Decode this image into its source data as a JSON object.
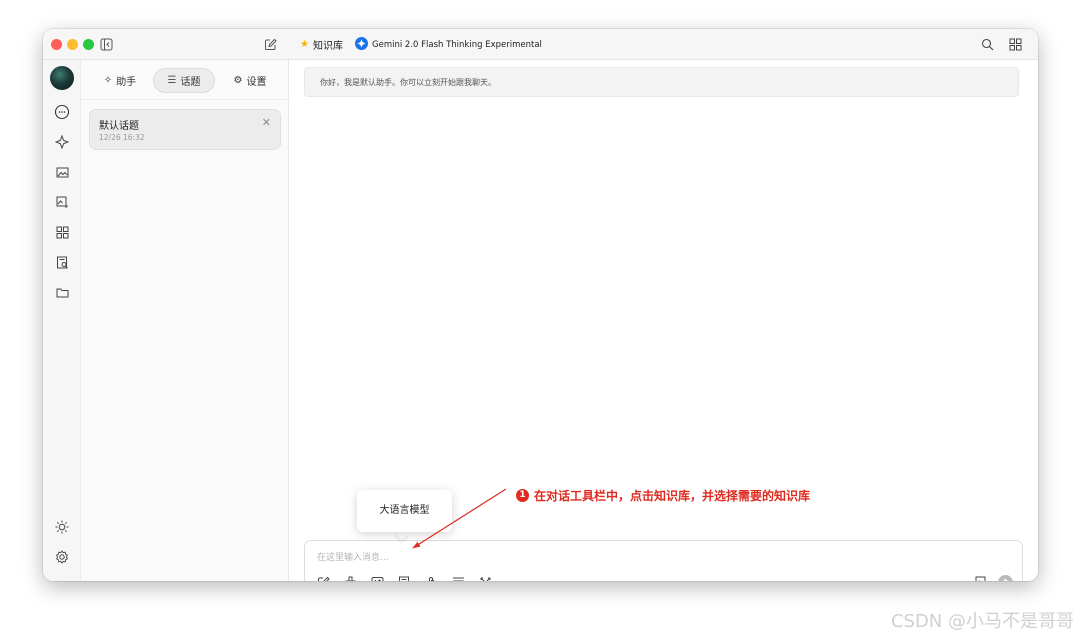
{
  "titlebar": {
    "knowledge_label": "知识库",
    "model_name": "Gemini 2.0 Flash Thinking Experimental"
  },
  "sidebar": {
    "tabs": [
      {
        "label": "助手",
        "icon": "sparkle-icon"
      },
      {
        "label": "话题",
        "icon": "list-icon"
      },
      {
        "label": "设置",
        "icon": "gear-icon"
      }
    ],
    "active_tab": "话题",
    "topics": [
      {
        "title": "默认话题",
        "time": "12/26 16:32"
      }
    ]
  },
  "chat": {
    "messages": [
      {
        "role": "assistant",
        "text": "你好，我是默认助手。你可以立刻开始跟我聊天。"
      }
    ]
  },
  "input": {
    "placeholder": "在这里输入消息..."
  },
  "tooltip": {
    "text": "大语言模型"
  },
  "annotation": {
    "number": "1",
    "text": "在对话工具栏中，点击知识库，并选择需要的知识库"
  },
  "watermark": "CSDN @小马不是哥哥",
  "colors": {
    "annotation": "#e02a20",
    "tl_red": "#fe5f57",
    "tl_yellow": "#febc2e",
    "tl_green": "#28c840",
    "gemini_blue": "#1a73e8"
  }
}
